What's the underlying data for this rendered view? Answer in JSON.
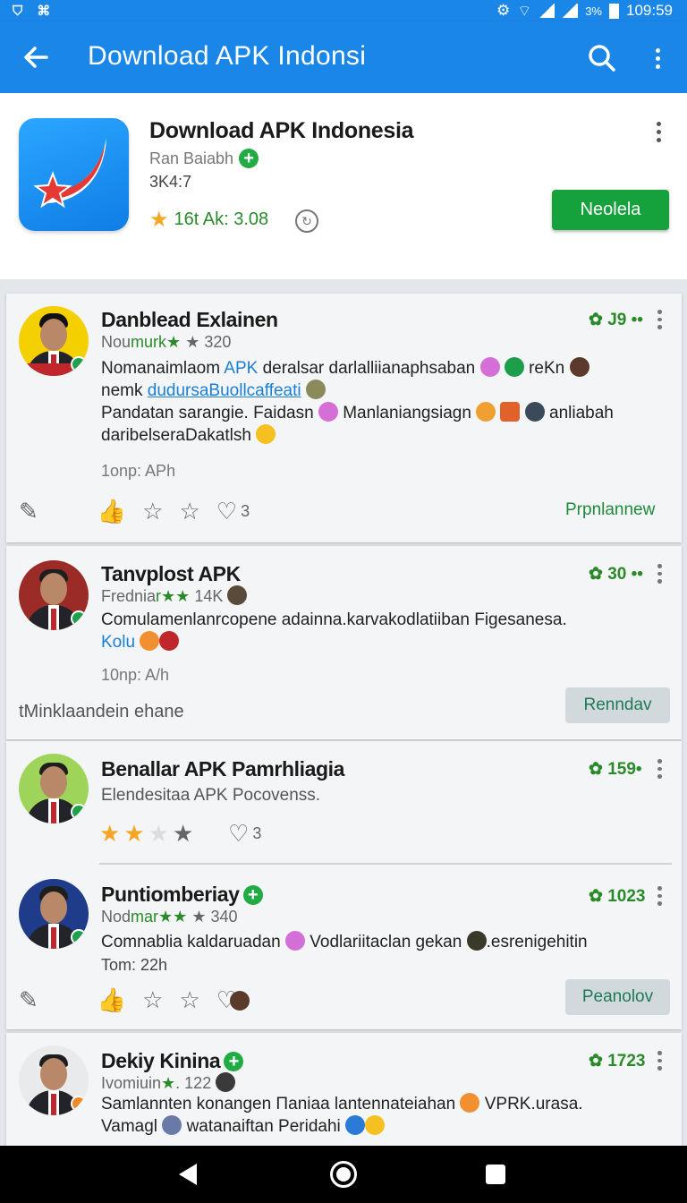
{
  "status": {
    "left_icons": [
      "shield-icon",
      "wifi-check-icon"
    ],
    "battery": "3%",
    "time": "109:59"
  },
  "appbar": {
    "title": "Download APK Indonsi"
  },
  "app": {
    "name": "Download APK Indonesia",
    "developer": "Ran Baiabh",
    "size": "3K4:7",
    "rating": "16t Ak: 3.08",
    "install_label": "Neolela",
    "icon_colors": {
      "bg": "#1a8ff0",
      "swoosh": "#e53935",
      "star": "#e53935"
    }
  },
  "posts": [
    {
      "name": "Danblead Exlainen",
      "meta_prefix": "Nou",
      "meta_green": "murk★",
      "meta_count": "★ 320",
      "score": "✿ J9 ••",
      "text_1": "Nomanaimlaom ",
      "text_link1": "APK",
      "text_2": " deralsar darlalliianaphsaban",
      "text_3": " reKn",
      "text_4": "nemk ",
      "text_link2": "dudursaBuollcaffeati",
      "text_5": "Pandatan sarangie. Faidasn",
      "text_6": "Manlaniangsiagn",
      "text_7": "anliabah",
      "text_8": "daribelseraDakatlsh",
      "time": "1onp: APh",
      "like_count": "3",
      "cta": "Prpnlannew"
    },
    {
      "name": "Tanvplost APK",
      "meta_prefix": "Frednia",
      "meta_green": "r★★",
      "meta_count": "14K",
      "score": "✿ 30 ••",
      "text_1": "Comulamenlanrcopene adainna.karvakodlatiiban Figesanesa.",
      "text_link": "Kolu",
      "time": "10np: A/h",
      "footer": "tMinklaandein ehane",
      "cta": "Renndav"
    },
    {
      "name": "Benallar APK Pamrhliagia",
      "subtitle": "Elendesitaa APK Pocovenss.",
      "score": "✿ 159•",
      "like_count": "3"
    },
    {
      "name": "Puntiomberiay",
      "meta_prefix": "Nod",
      "meta_green": "mar★★",
      "meta_count": "★ 340",
      "score": "✿ 1023",
      "text_1": "Comnablia kaldaruadan",
      "text_2": "Vodlariitaclan gekan",
      "text_3": ".esrenigehitin",
      "time": "Tom: 22h",
      "cta": "Peanolov"
    },
    {
      "name": "Dekiy Kinina",
      "meta_prefix": "Ivomiuin",
      "meta_green": "★",
      "meta_count": ". 122",
      "score": "✿ 1723",
      "text_1": "Samlannten konangen Πaniaa lantennateiahan",
      "text_2": "VPRK.urasa.",
      "text_3": "Vamagl",
      "text_4": "watanaiftan Peridahi"
    }
  ]
}
